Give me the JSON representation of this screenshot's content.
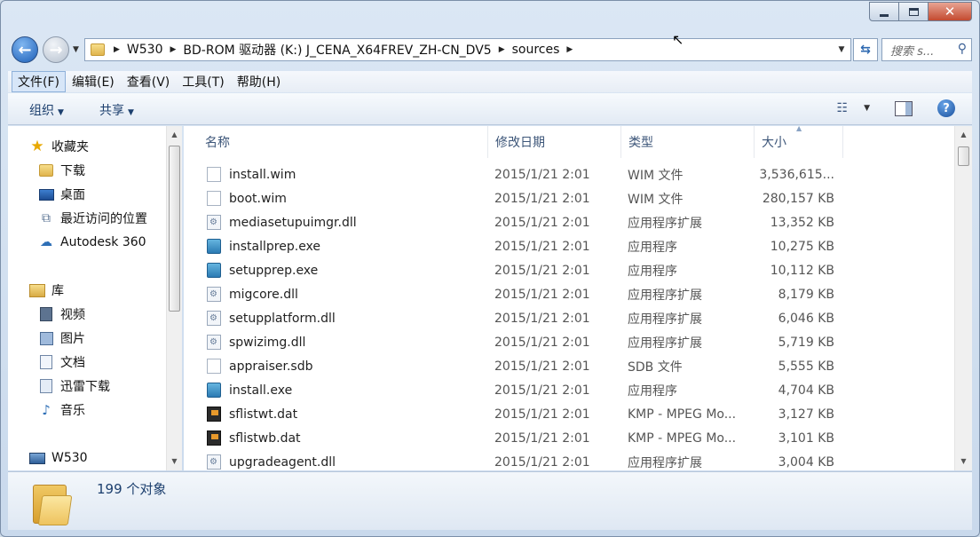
{
  "window": {
    "minimize_symbol": "",
    "maximize_symbol": "",
    "close_symbol": "✕"
  },
  "nav": {
    "back_symbol": "←",
    "forward_symbol": "→"
  },
  "address": {
    "breadcrumbs": [
      "W530",
      "BD-ROM 驱动器 (K:) J_CENA_X64FREV_ZH-CN_DV5",
      "sources"
    ],
    "separator": "▶"
  },
  "search": {
    "placeholder": "搜索 s..."
  },
  "menu": {
    "items": [
      "文件(F)",
      "编辑(E)",
      "查看(V)",
      "工具(T)",
      "帮助(H)"
    ]
  },
  "commands": {
    "organize": "组织",
    "share": "共享"
  },
  "sidebar": {
    "favorites": "收藏夹",
    "downloads": "下载",
    "desktop": "桌面",
    "recent": "最近访问的位置",
    "autodesk": "Autodesk 360",
    "libraries": "库",
    "videos": "视频",
    "pictures": "图片",
    "documents": "文档",
    "xunlei": "迅雷下载",
    "music": "音乐",
    "computer": "W530"
  },
  "columns": {
    "name": "名称",
    "date": "修改日期",
    "type": "类型",
    "size": "大小"
  },
  "files": [
    {
      "name": "install.wim",
      "date": "2015/1/21 2:01",
      "type": "WIM 文件",
      "size": "3,536,615...",
      "icon": "blank"
    },
    {
      "name": "boot.wim",
      "date": "2015/1/21 2:01",
      "type": "WIM 文件",
      "size": "280,157 KB",
      "icon": "blank"
    },
    {
      "name": "mediasetupuimgr.dll",
      "date": "2015/1/21 2:01",
      "type": "应用程序扩展",
      "size": "13,352 KB",
      "icon": "dll"
    },
    {
      "name": "installprep.exe",
      "date": "2015/1/21 2:01",
      "type": "应用程序",
      "size": "10,275 KB",
      "icon": "exe"
    },
    {
      "name": "setupprep.exe",
      "date": "2015/1/21 2:01",
      "type": "应用程序",
      "size": "10,112 KB",
      "icon": "exe"
    },
    {
      "name": "migcore.dll",
      "date": "2015/1/21 2:01",
      "type": "应用程序扩展",
      "size": "8,179 KB",
      "icon": "dll"
    },
    {
      "name": "setupplatform.dll",
      "date": "2015/1/21 2:01",
      "type": "应用程序扩展",
      "size": "6,046 KB",
      "icon": "dll"
    },
    {
      "name": "spwizimg.dll",
      "date": "2015/1/21 2:01",
      "type": "应用程序扩展",
      "size": "5,719 KB",
      "icon": "dll"
    },
    {
      "name": "appraiser.sdb",
      "date": "2015/1/21 2:01",
      "type": "SDB 文件",
      "size": "5,555 KB",
      "icon": "blank"
    },
    {
      "name": "install.exe",
      "date": "2015/1/21 2:01",
      "type": "应用程序",
      "size": "4,704 KB",
      "icon": "exe"
    },
    {
      "name": "sflistwt.dat",
      "date": "2015/1/21 2:01",
      "type": "KMP - MPEG Mo...",
      "size": "3,127 KB",
      "icon": "kmp"
    },
    {
      "name": "sflistwb.dat",
      "date": "2015/1/21 2:01",
      "type": "KMP - MPEG Mo...",
      "size": "3,101 KB",
      "icon": "kmp"
    },
    {
      "name": "upgradeagent.dll",
      "date": "2015/1/21 2:01",
      "type": "应用程序扩展",
      "size": "3,004 KB",
      "icon": "dll"
    }
  ],
  "status": {
    "count": "199 个对象"
  },
  "colors": {
    "accent": "#1c3f6e",
    "header_text": "#3d5679"
  }
}
